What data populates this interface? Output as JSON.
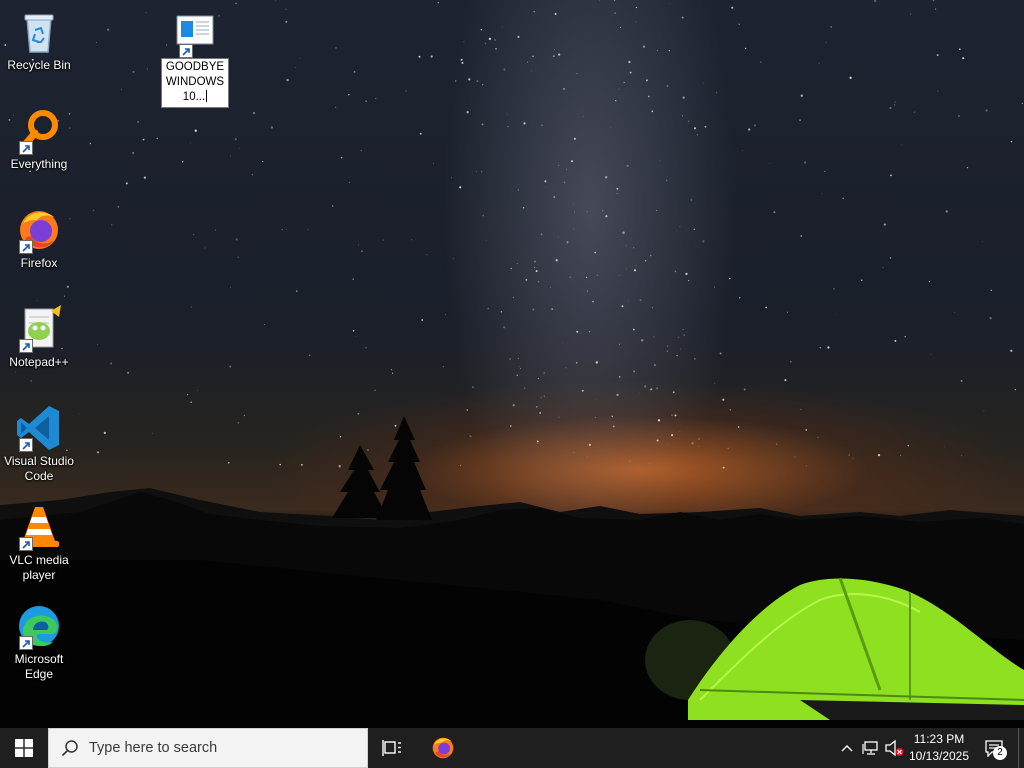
{
  "desktop": {
    "icons": [
      {
        "label": "Recycle Bin"
      },
      {
        "label": "Everything"
      },
      {
        "label": "Firefox"
      },
      {
        "label": "Notepad++"
      },
      {
        "label": "Visual Studio Code"
      },
      {
        "label": "VLC media player"
      },
      {
        "label": "Microsoft Edge"
      }
    ],
    "renaming_shortcut": {
      "label_line1": "GOODBYE",
      "label_line2": "WINDOWS",
      "label_line3": "10..."
    }
  },
  "taskbar": {
    "search_placeholder": "Type here to search",
    "clock_time": "11:23 PM",
    "clock_date": "10/13/2025",
    "notification_count": "2"
  },
  "colors": {
    "taskbar_bg": "#1f1f1f",
    "search_bg": "#f3f3f3",
    "windows_blue": "#1e88e5",
    "tent_green": "#8fe020"
  }
}
